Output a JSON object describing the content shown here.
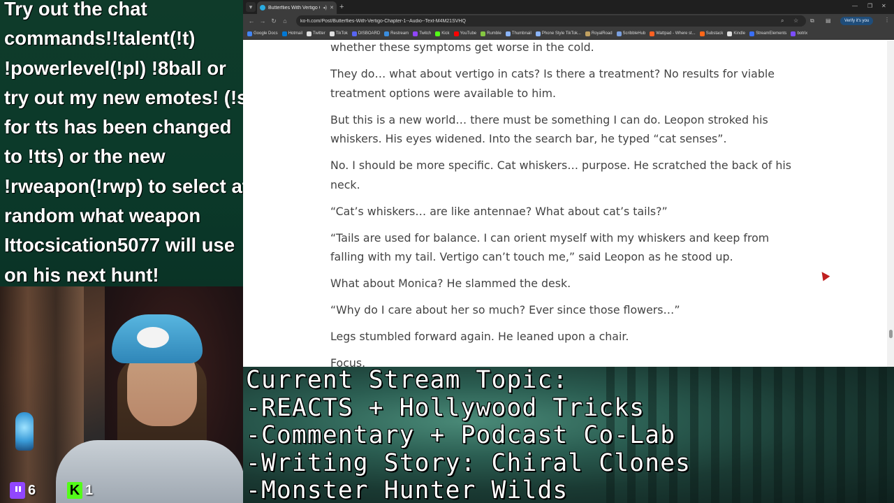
{
  "chat_overlay": {
    "lines": [
      "Try out the chat",
      "commands!!talent(!t)",
      "!powerlevel(!pl) !8ball or",
      "try out my new emotes! (!s",
      "for tts has been changed",
      "to !tts) or the new",
      "!rweapon(!rwp) to select at",
      "random what weapon",
      "Ittocsication5077 will use",
      "on his next hunt!"
    ]
  },
  "webcam": {
    "twitch_count": "6",
    "kick_count": "1",
    "twitch_color": "#9146ff",
    "kick_color": "#53fc18"
  },
  "browser": {
    "tab_title": "Butterflies With Vertigo Ch",
    "url": "ko-fi.com/Post/Butterflies-With-Vertigo-Chapter-1--Audio--Text-M4M21SVHQ",
    "verify_label": "Verify it's you",
    "bookmarks": [
      {
        "label": "Google Docs",
        "color": "#4285f4"
      },
      {
        "label": "Hotmail",
        "color": "#0078d4"
      },
      {
        "label": "Twitter",
        "color": "#e0e0e0"
      },
      {
        "label": "TikTok",
        "color": "#e0e0e0"
      },
      {
        "label": "DISBOARD",
        "color": "#5865f2"
      },
      {
        "label": "Restream",
        "color": "#3a8dde"
      },
      {
        "label": "Twitch",
        "color": "#9146ff"
      },
      {
        "label": "Kick",
        "color": "#53fc18"
      },
      {
        "label": "YouTube",
        "color": "#ff0000"
      },
      {
        "label": "Rumble",
        "color": "#85c742"
      },
      {
        "label": "Thumbnail",
        "color": "#8ab4f8"
      },
      {
        "label": "Phone Style TikTok...",
        "color": "#8ab4f8"
      },
      {
        "label": "RoyalRoad",
        "color": "#c0a060"
      },
      {
        "label": "ScribbleHub",
        "color": "#7aa0e0"
      },
      {
        "label": "Wattpad - Where st...",
        "color": "#ff6122"
      },
      {
        "label": "Substack",
        "color": "#ff6719"
      },
      {
        "label": "Kindle",
        "color": "#e0e0e0"
      },
      {
        "label": "StreamElements",
        "color": "#3a6ff7"
      },
      {
        "label": "botrix",
        "color": "#7c4dff"
      }
    ],
    "article_paragraphs": [
      "whether these symptoms get worse in the cold.",
      "They do… what about vertigo in cats? Is there a treatment? No results for viable treatment options were available to him.",
      "But this is a new world… there must be something I can do. Leopon stroked his whiskers. His eyes widened. Into the search bar, he typed “cat senses”.",
      "No. I should be more specific. Cat whiskers… purpose. He scratched the back of his neck.",
      "“Cat’s whiskers… are like antennae? What about cat’s tails?”",
      "“Tails are used for balance. I can orient myself with my whiskers and keep from falling with my tail. Vertigo can’t touch me,” said Leopon as he stood up.",
      "What about Monica? He slammed the desk.",
      "“Why do I care about her so much? Ever since those flowers…”",
      "Legs stumbled forward again. He leaned upon a chair.",
      "Focus."
    ]
  },
  "topic_panel": {
    "lines": [
      "Current Stream Topic:",
      "-REACTS + Hollywood Tricks",
      "-Commentary + Podcast Co-Lab",
      "-Writing Story: Chiral Clones",
      "-Monster Hunter Wilds"
    ]
  }
}
